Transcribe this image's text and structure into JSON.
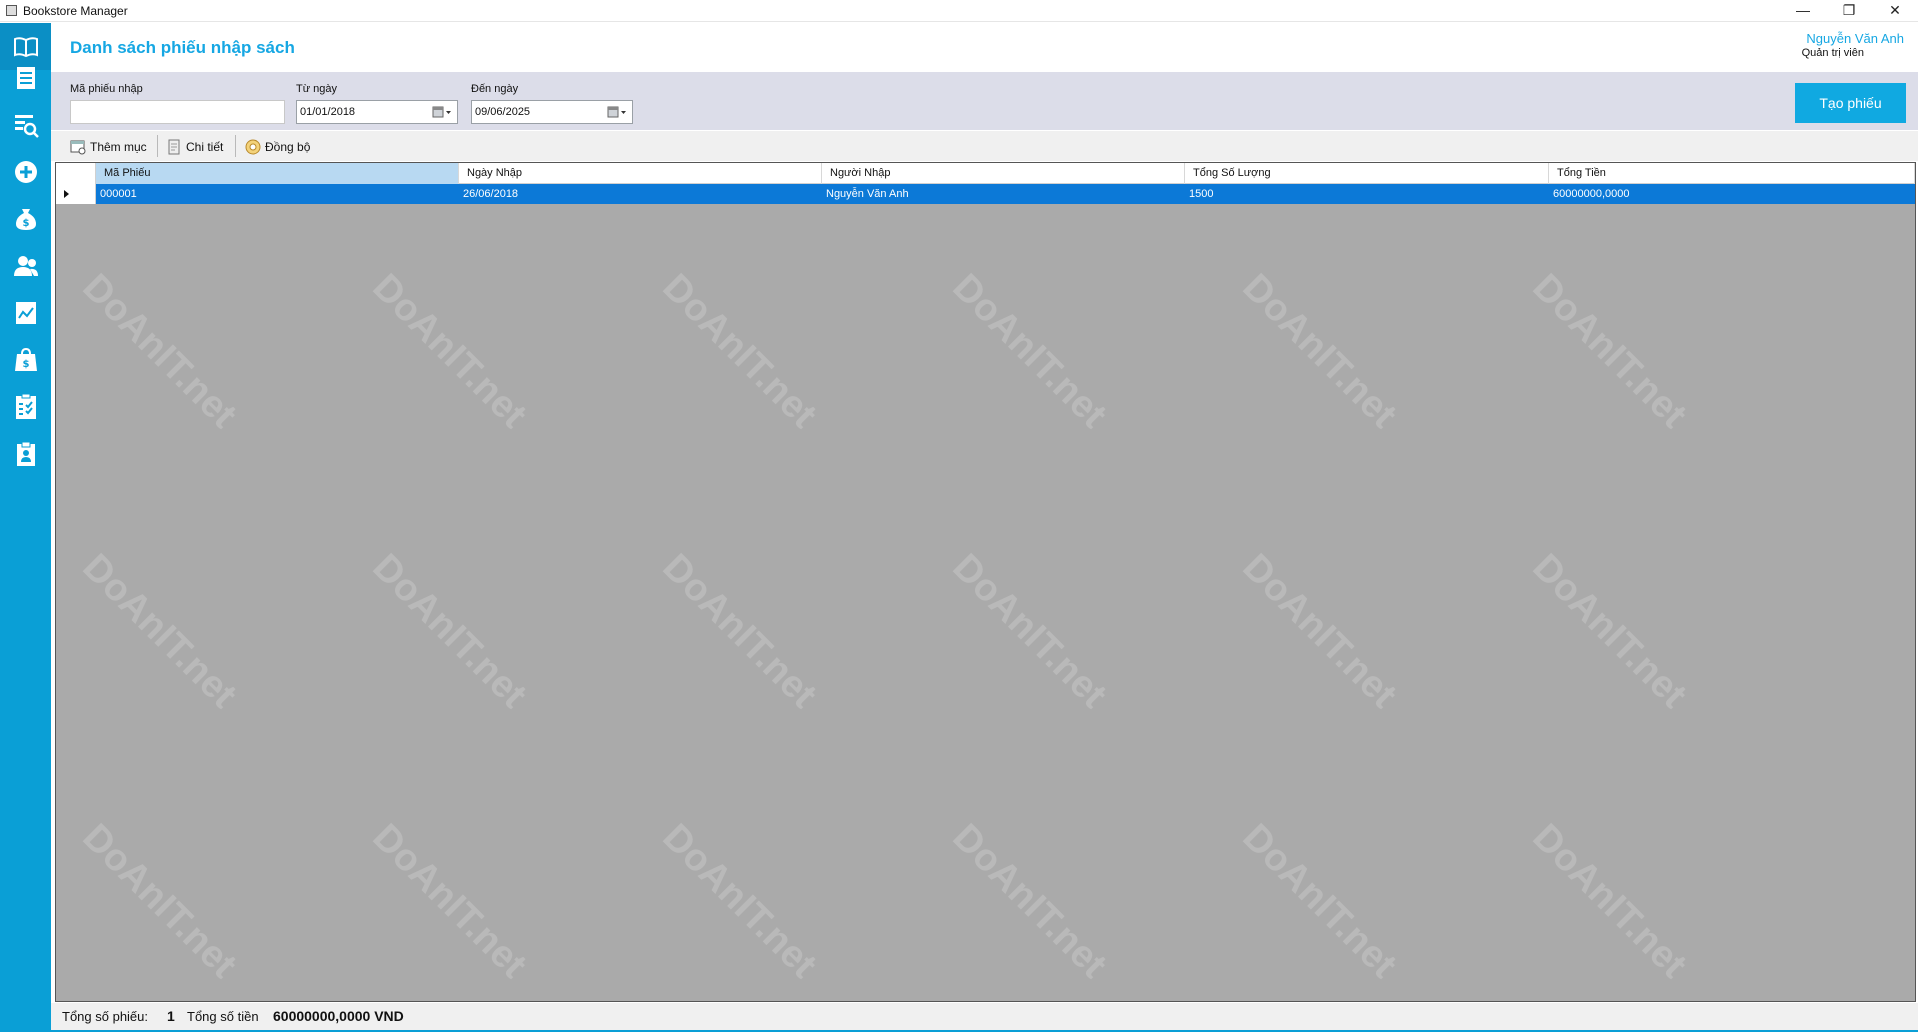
{
  "window": {
    "title": "Bookstore Manager",
    "min_glyph": "—",
    "max_glyph": "❐",
    "close_glyph": "✕"
  },
  "sidebar": {
    "items": [
      {
        "icon": "book-open-icon",
        "active": true
      },
      {
        "icon": "list-document-icon"
      },
      {
        "icon": "search-list-icon"
      },
      {
        "icon": "add-circle-icon"
      },
      {
        "icon": "money-bag-icon"
      },
      {
        "icon": "users-icon"
      },
      {
        "icon": "chart-line-icon"
      },
      {
        "icon": "shopping-bag-icon"
      },
      {
        "icon": "checklist-icon"
      },
      {
        "icon": "clipboard-icon"
      }
    ]
  },
  "header": {
    "page_title": "Danh sách phiếu nhập sách",
    "user_name": "Nguyễn Văn Anh",
    "user_role": "Quản trị viên"
  },
  "filters": {
    "receipt_code_label": "Mã phiếu nhập",
    "receipt_code_value": "",
    "from_date_label": "Từ ngày",
    "from_date_value": "01/01/2018",
    "to_date_label": "Đến ngày",
    "to_date_value": "09/06/2025",
    "create_button": "Tạo phiếu"
  },
  "toolbar": {
    "add_label": "Thêm mục",
    "detail_label": "Chi tiết",
    "sync_label": "Đồng bộ"
  },
  "grid": {
    "columns": [
      "Mã Phiếu",
      "Ngày Nhập",
      "Người Nhập",
      "Tổng Số Lượng",
      "Tổng Tiền"
    ],
    "rows": [
      [
        "000001",
        "26/06/2018",
        "Nguyễn Văn Anh",
        "1500",
        "60000000,0000"
      ]
    ]
  },
  "status": {
    "count_label": "Tổng số phiếu:",
    "count_value": "1",
    "total_label": "Tổng số tiền",
    "total_value": "60000000,0000 VND"
  },
  "watermark": {
    "text": "DoAnIT.net"
  },
  "colors": {
    "accent": "#0a9fd6",
    "title": "#16a7e3",
    "selected_row": "#0c79d7",
    "grid_bg": "#aaaaaa",
    "filter_bg": "#dcdde9"
  }
}
